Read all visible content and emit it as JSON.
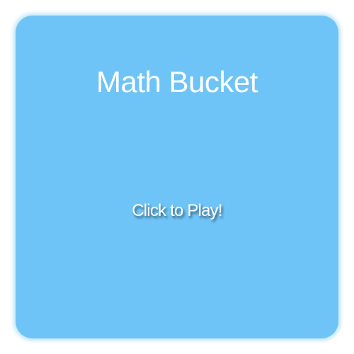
{
  "game": {
    "title": "Math Bucket",
    "play_label": "Click to Play!"
  },
  "colors": {
    "panel_background": "#6ec4f6",
    "text": "#ffffff",
    "page_background": "#ffffff"
  }
}
